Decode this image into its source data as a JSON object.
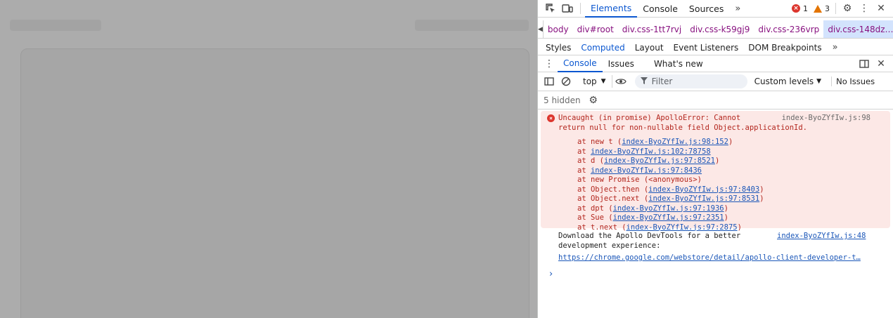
{
  "devtools": {
    "tabs": [
      "Elements",
      "Console",
      "Sources"
    ],
    "active_tab": "Elements",
    "error_count": "1",
    "warning_count": "3",
    "breadcrumbs": [
      "body",
      "div#root",
      "div.css-1tt7rvj",
      "div.css-k59gj9",
      "div.css-236vrp",
      "div.css-148dz…"
    ],
    "subtabs": [
      "Styles",
      "Computed",
      "Layout",
      "Event Listeners",
      "DOM Breakpoints"
    ],
    "drawer_tabs": [
      "Console",
      "Issues",
      "What's new"
    ],
    "context": "top",
    "filter_placeholder": "Filter",
    "levels": "Custom levels",
    "issues": "No Issues",
    "hidden": "5 hidden"
  },
  "console": {
    "error": {
      "message_line1": "Uncaught (in promise) ApolloError: Cannot",
      "message_line2": "return null for non-nullable field Object.applicationId.",
      "source": "index-ByoZYfIw.js:98",
      "stack": [
        {
          "prefix": "at new t (",
          "link": "index-ByoZYfIw.js:98:152",
          "suffix": ")"
        },
        {
          "prefix": "at ",
          "link": "index-ByoZYfIw.js:102:78758",
          "suffix": ""
        },
        {
          "prefix": "at d (",
          "link": "index-ByoZYfIw.js:97:8521",
          "suffix": ")"
        },
        {
          "prefix": "at ",
          "link": "index-ByoZYfIw.js:97:8436",
          "suffix": ""
        },
        {
          "prefix": "at new Promise (<anonymous>)",
          "link": "",
          "suffix": ""
        },
        {
          "prefix": "at Object.then (",
          "link": "index-ByoZYfIw.js:97:8403",
          "suffix": ")"
        },
        {
          "prefix": "at Object.next (",
          "link": "index-ByoZYfIw.js:97:8531",
          "suffix": ")"
        },
        {
          "prefix": "at dpt (",
          "link": "index-ByoZYfIw.js:97:1936",
          "suffix": ")"
        },
        {
          "prefix": "at Sue (",
          "link": "index-ByoZYfIw.js:97:2351",
          "suffix": ")"
        },
        {
          "prefix": "at t.next (",
          "link": "index-ByoZYfIw.js:97:2875",
          "suffix": ")"
        }
      ]
    },
    "info": {
      "line1": "Download the Apollo DevTools for a better",
      "line2": "development experience:",
      "link": "https://chrome.google.com/webstore/detail/apollo-client-developer-t…",
      "source": "index-ByoZYfIw.js:48"
    },
    "prompt": "›"
  }
}
